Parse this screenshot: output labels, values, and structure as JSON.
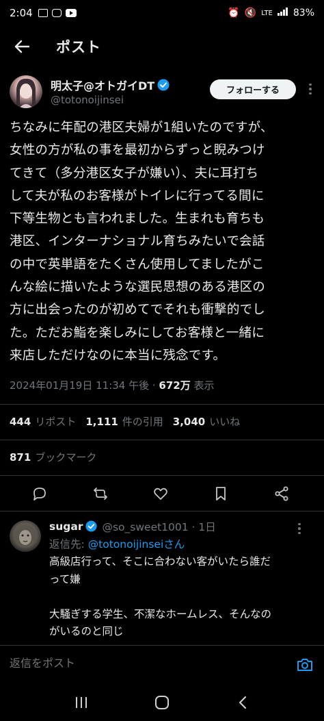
{
  "status_bar": {
    "time": "2:04",
    "network": "LTE",
    "battery": "83%"
  },
  "header": {
    "title": "ポスト"
  },
  "post": {
    "author_name": "明太子@オトガイDT",
    "author_handle": "@totonoijinsei",
    "follow_label": "フォローする",
    "body": "ちなみに年配の港区夫婦が1組いたのですが、\n女性の方が私の事を最初からずっと睨みつけ\nてきて（多分港区女子が嫌い）、夫に耳打ち\nして夫が私のお客様がトイレに行ってる間に\n下等生物とも言われました。生まれも育ちも\n港区、インターナショナル育ちみたいで会話\nの中で英単語をたくさん使用してましたがこ\nんな絵に描いたような選民思想のある港区の\n方に出会ったのが初めてでそれも衝撃的でし\nた。ただお鮨を楽しみにしてお客様と一緒に\n来店しただけなのに本当に残念です。",
    "timestamp": "2024年01月19日 11:34 午後 · ",
    "views": "672万",
    "views_label": " 表示",
    "reposts": "444",
    "reposts_label": "リポスト",
    "quotes": "1,111",
    "quotes_label": "件の引用",
    "likes": "3,040",
    "likes_label": "いいね",
    "bookmarks": "871",
    "bookmarks_label": "ブックマーク"
  },
  "reply": {
    "name": "sugar",
    "handle": "@so_sweet1001 · 1日",
    "replying_prefix": "返信先: ",
    "replying_to": "@totonoijinseiさん",
    "text": "高級店行って、そこに合わない客がいたら誰だ\nって嫌\n\n大騒ぎする学生、不潔なホームレス、そんなの\nがいるのと同じ"
  },
  "compose": {
    "placeholder": "返信をポスト"
  },
  "colors": {
    "accent": "#1d9bf0",
    "text": "#e7e9ea",
    "muted": "#71767b",
    "divider": "#2f3336"
  }
}
